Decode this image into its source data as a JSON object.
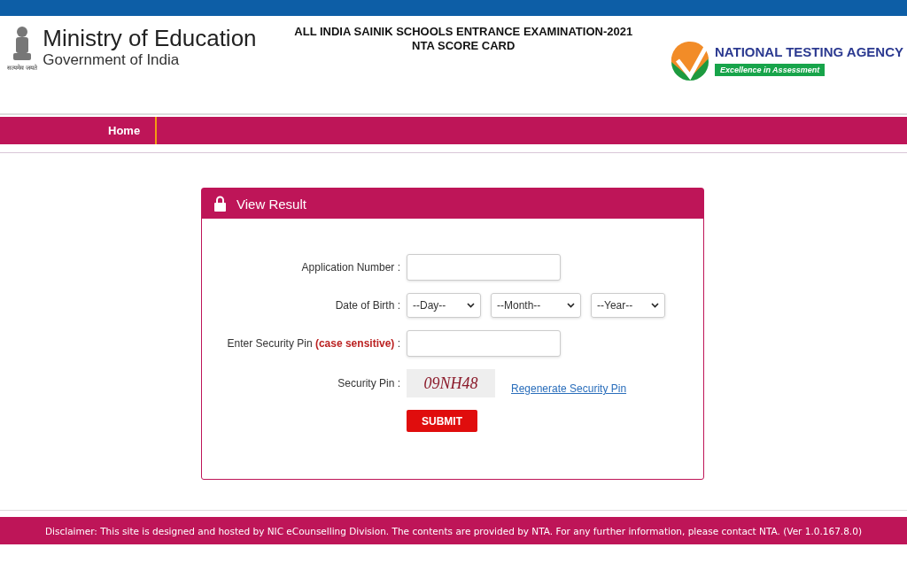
{
  "header": {
    "ministry_title": "Ministry of Education",
    "ministry_subtitle": "Government of India",
    "emblem_motto": "सत्यमेव जयते",
    "exam_title": "ALL INDIA SAINIK SCHOOLS ENTRANCE EXAMINATION-2021",
    "exam_subtitle": "NTA SCORE CARD",
    "agency_name": "NATIONAL TESTING AGENCY",
    "agency_tagline": "Excellence in Assessment"
  },
  "nav": [
    {
      "label": "Home",
      "selected": true
    }
  ],
  "panel": {
    "title": "View Result",
    "application_number": {
      "label": "Application Number :"
    },
    "date_of_birth": {
      "label": "Date of Birth :",
      "selects": [
        "--Day--",
        "--Month--",
        "--Year--"
      ]
    },
    "security_pin_input": {
      "label": "Enter Security Pin",
      "note": "(case sensitive)",
      "colon": ":"
    },
    "security_pin": {
      "label": "Security Pin :",
      "captcha": "09NH48",
      "regenerate_link": "Regenerate Security Pin"
    },
    "submit": "SUBMIT"
  },
  "footer": {
    "disclaimer": "Disclaimer: This site is designed and hosted by NIC eCounselling Division. The contents are provided by NTA. For any further information, please contact NTA. (Ver 1.0.167.8.0)"
  }
}
